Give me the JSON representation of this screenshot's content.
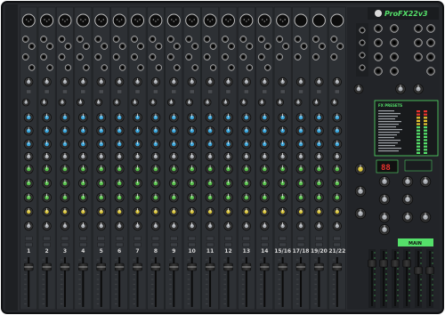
{
  "mixer": {
    "brand": "ProFX22v3",
    "fx_presets_title": "FX PRESETS",
    "display_readout": "88",
    "main_label": "MAIN"
  },
  "channels": {
    "labels": [
      "1",
      "2",
      "3",
      "4",
      "5",
      "6",
      "7",
      "8",
      "9",
      "10",
      "11",
      "12",
      "13",
      "14",
      "15/16",
      "17/18",
      "19/20",
      "21/22"
    ]
  },
  "colors": {
    "chassis": "#24262a",
    "strip": "#2d3034",
    "accent_green": "#55e06a",
    "knob_blue": "#3aa6dc",
    "knob_green": "#56c24a",
    "knob_yellow": "#d8c43a",
    "knob_gray": "#a9adb3"
  }
}
